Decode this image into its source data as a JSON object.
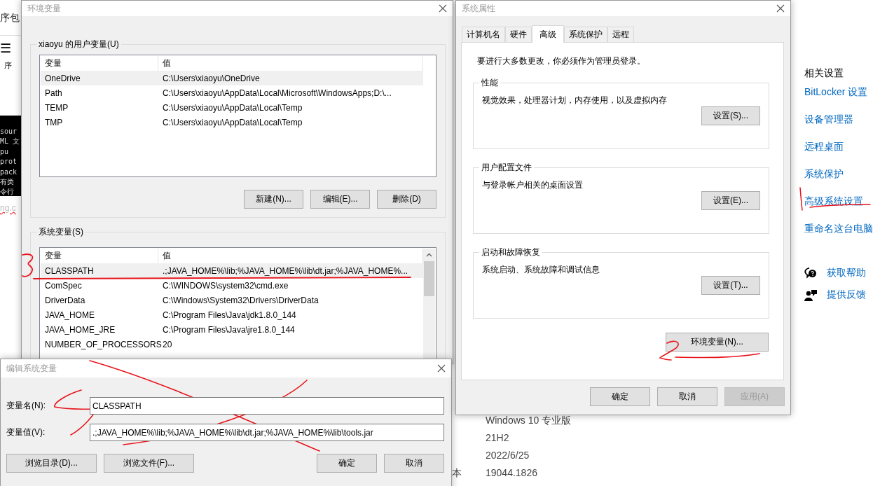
{
  "left_fragments": {
    "title": "序包",
    "menu_glyph": "☰",
    "menu_label": "序",
    "console_lines": [
      "sour",
      "ML 文",
      "pu",
      "prot",
      "pack",
      "有类",
      "令行"
    ],
    "url": "ng.c"
  },
  "env_window": {
    "title": "环境变量",
    "user_group": {
      "label": "xiaoyu 的用户变量(U)",
      "columns": [
        "变量",
        "值"
      ],
      "rows": [
        {
          "name": "OneDrive",
          "value": "C:\\Users\\xiaoyu\\OneDrive",
          "selected": true
        },
        {
          "name": "Path",
          "value": "C:\\Users\\xiaoyu\\AppData\\Local\\Microsoft\\WindowsApps;D:\\...",
          "selected": false
        },
        {
          "name": "TEMP",
          "value": "C:\\Users\\xiaoyu\\AppData\\Local\\Temp",
          "selected": false
        },
        {
          "name": "TMP",
          "value": "C:\\Users\\xiaoyu\\AppData\\Local\\Temp",
          "selected": false
        }
      ],
      "buttons": [
        "新建(N)...",
        "编辑(E)...",
        "删除(D)"
      ]
    },
    "system_group": {
      "label": "系统变量(S)",
      "columns": [
        "变量",
        "值"
      ],
      "rows": [
        {
          "name": "CLASSPATH",
          "value": ".;JAVA_HOME%\\lib;%JAVA_HOME%\\lib\\dt.jar;%JAVA_HOME%...",
          "selected": true
        },
        {
          "name": "ComSpec",
          "value": "C:\\WINDOWS\\system32\\cmd.exe",
          "selected": false
        },
        {
          "name": "DriverData",
          "value": "C:\\Windows\\System32\\Drivers\\DriverData",
          "selected": false
        },
        {
          "name": "JAVA_HOME",
          "value": "C:\\Program Files\\Java\\jdk1.8.0_144",
          "selected": false
        },
        {
          "name": "JAVA_HOME_JRE",
          "value": "C:\\Program Files\\Java\\jre1.8.0_144",
          "selected": false
        },
        {
          "name": "NUMBER_OF_PROCESSORS",
          "value": "20",
          "selected": false
        }
      ]
    }
  },
  "edit_dialog": {
    "title": "编辑系统变量",
    "fields": [
      {
        "label": "变量名(N):",
        "value": "CLASSPATH"
      },
      {
        "label": "变量值(V):",
        "value": ".;JAVA_HOME%\\lib;%JAVA_HOME%\\lib\\dt.jar;%JAVA_HOME%\\lib\\tools.jar"
      }
    ],
    "left_buttons": [
      "浏览目录(D)...",
      "浏览文件(F)..."
    ],
    "right_buttons": [
      "确定",
      "取消"
    ]
  },
  "system_properties": {
    "title": "系统属性",
    "tabs": [
      {
        "label": "计算机名",
        "selected": false
      },
      {
        "label": "硬件",
        "selected": false
      },
      {
        "label": "高级",
        "selected": true
      },
      {
        "label": "系统保护",
        "selected": false
      },
      {
        "label": "远程",
        "selected": false
      }
    ],
    "notice": "要进行大多数更改，你必须作为管理员登录。",
    "groups": [
      {
        "label": "性能",
        "description": "视觉效果，处理器计划，内存使用，以及虚拟内存",
        "button": "设置(S)..."
      },
      {
        "label": "用户配置文件",
        "description": "与登录帐户相关的桌面设置",
        "button": "设置(E)..."
      },
      {
        "label": "启动和故障恢复",
        "description": "系统启动、系统故障和调试信息",
        "button": "设置(T)..."
      }
    ],
    "env_button": "环境变量(N)...",
    "buttons": [
      {
        "label": "确定",
        "disabled": false
      },
      {
        "label": "取消",
        "disabled": false
      },
      {
        "label": "应用(A)",
        "disabled": true
      }
    ]
  },
  "about": {
    "cut_label": "本",
    "values": [
      "Windows 10 专业版",
      "21H2",
      "2022/6/25",
      "19044.1826"
    ]
  },
  "related_settings": {
    "heading": "相关设置",
    "links": [
      "BitLocker 设置",
      "设备管理器",
      "远程桌面",
      "系统保护",
      "高级系统设置",
      "重命名这台电脑"
    ]
  },
  "help_links": [
    {
      "kind": "help",
      "label": "获取帮助"
    },
    {
      "kind": "feedback",
      "label": "提供反馈"
    }
  ]
}
